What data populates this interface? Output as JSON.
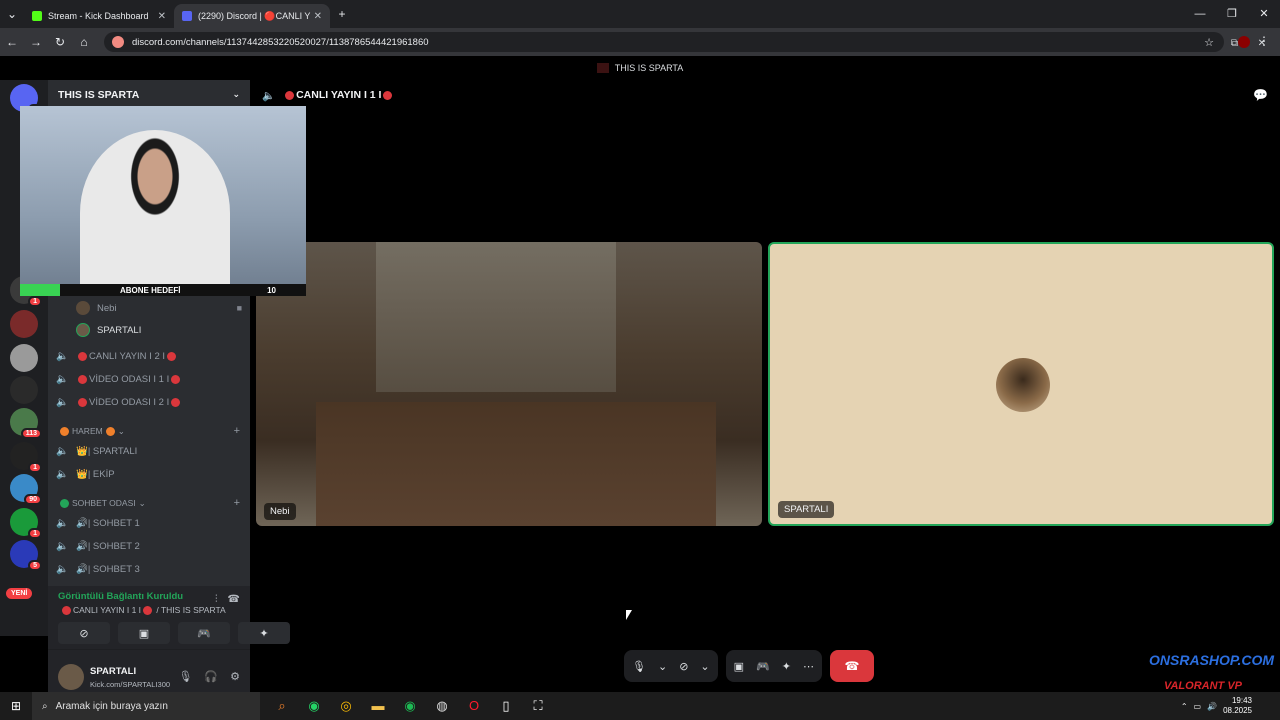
{
  "browser": {
    "tabs": [
      {
        "title": "Stream - Kick Dashboard",
        "active": false,
        "favicon_color": "#53fc18"
      },
      {
        "title": "(2290) Discord | 🔴CANLI Y",
        "active": true,
        "favicon_color": "#5865f2"
      }
    ],
    "new_tab": "+",
    "url": "discord.com/channels/1137442853220520027/1138786544421961860"
  },
  "app": {
    "window_title": "THIS IS SPARTA",
    "server_name": "THIS IS SPARTA",
    "guild_badges": [
      "1",
      "1",
      "113",
      "1",
      "90",
      "1",
      "5"
    ],
    "yeni_label": "YENİ",
    "voice_members": [
      {
        "name": "Nebi"
      },
      {
        "name": "SPARTALI"
      }
    ],
    "channels_top": [
      {
        "name": "CANLI YAYIN I 2 I"
      },
      {
        "name": "VİDEO ODASI I 1 I"
      },
      {
        "name": "VİDEO ODASI I 2 I"
      }
    ],
    "category_harem": "HAREM",
    "harem_channels": [
      {
        "name": "👑| SPARTALI"
      },
      {
        "name": "👑| EKİP"
      }
    ],
    "category_sohbet": "SOHBET ODASI",
    "sohbet_channels": [
      {
        "name": "🔊| SOHBET 1"
      },
      {
        "name": "🔊| SOHBET 2"
      },
      {
        "name": "🔊| SOHBET 3"
      }
    ],
    "voice_status": "Görüntülü Bağlantı Kuruldu",
    "voice_sub": "CANLI YAYIN I 1 I",
    "voice_sub_server": "/ THIS IS SPARTA",
    "user": {
      "name": "SPARTALI",
      "status": "Kick.com/SPARTALI300"
    },
    "channel_header": "CANLI YAYIN I 1 I",
    "tiles": [
      {
        "label": "Nebi"
      },
      {
        "label": "SPARTALI",
        "speaking_color": "#23a559"
      }
    ],
    "webcam_banner": "ABONE HEDEFİ",
    "webcam_count": "10"
  },
  "overlay": {
    "brand_top": "ONSRASHOP.COM",
    "brand_bottom": "VALORANT VP"
  },
  "taskbar": {
    "search_placeholder": "Aramak için buraya yazın",
    "time": "19:43",
    "date": "08.2025"
  },
  "colors": {
    "accent_red": "#da373c",
    "online_green": "#23a559",
    "sidebar_bg": "#2b2d31"
  }
}
